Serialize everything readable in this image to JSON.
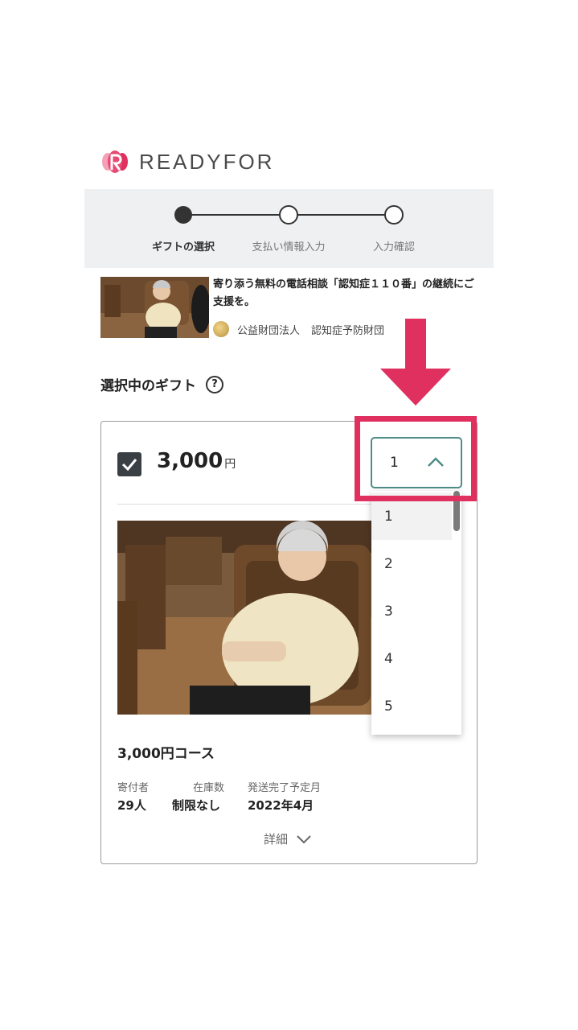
{
  "brand": {
    "name": "READYFOR",
    "accent": "#e0305f"
  },
  "stepper": {
    "steps": [
      "ギフトの選択",
      "支払い情報入力",
      "入力確認"
    ],
    "active_index": 0
  },
  "project": {
    "title": "寄り添う無料の電話相談「認知症１１０番」の継続にご支援を。",
    "org_parts": [
      "公益財団法人",
      "認知症予防財団"
    ]
  },
  "section": {
    "title": "選択中のギフト",
    "help_icon": "question-circle-icon"
  },
  "gift": {
    "checked": true,
    "price": "3,000",
    "price_unit": "円",
    "course_name": "3,000円コース",
    "meta": {
      "supporters_label": "寄付者",
      "supporters_value": "29人",
      "stock_label": "在庫数",
      "stock_value": "制限なし",
      "ship_label": "発送完了予定月",
      "ship_value": "2022年4月"
    },
    "details_label": "詳細"
  },
  "quantity": {
    "selected": "1",
    "options": [
      "1",
      "2",
      "3",
      "4",
      "5"
    ]
  },
  "colors": {
    "select_border": "#4e8c88",
    "highlight": "#e0305f",
    "checkbox": "#3a3f45"
  }
}
